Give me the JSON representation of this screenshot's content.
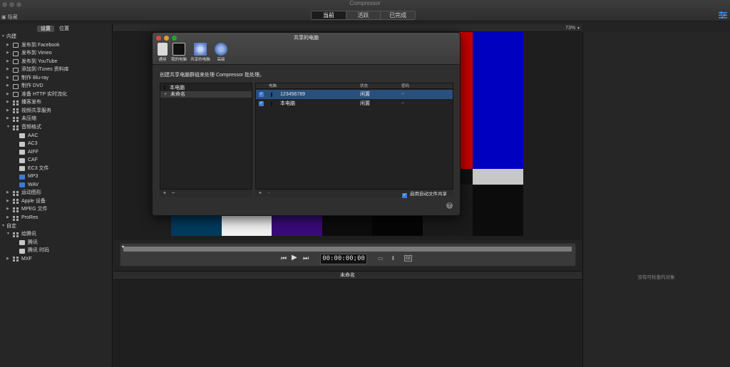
{
  "window": {
    "title": "Compressor",
    "segments": [
      "当前",
      "活跃",
      "已完成"
    ],
    "active_segment": 0,
    "sidebar_toggle": "隐藏"
  },
  "sidebar": {
    "tabs": [
      "设置",
      "位置"
    ],
    "active_tab": 0,
    "items": [
      {
        "label": "内建",
        "level": 0,
        "expanded": true,
        "icon": "none"
      },
      {
        "label": "发布到 Facebook",
        "level": 1,
        "icon": "share-icon"
      },
      {
        "label": "发布到 Vimeo",
        "level": 1,
        "icon": "share-icon"
      },
      {
        "label": "发布到 YouTube",
        "level": 1,
        "icon": "share-icon"
      },
      {
        "label": "添加到 iTunes 资料库",
        "level": 1,
        "icon": "share-icon"
      },
      {
        "label": "制作 Blu-ray",
        "level": 1,
        "icon": "share-icon"
      },
      {
        "label": "制作 DVD",
        "level": 1,
        "icon": "share-icon"
      },
      {
        "label": "准备 HTTP 实时流化",
        "level": 1,
        "icon": "share-icon"
      },
      {
        "label": "播客发布",
        "level": 1,
        "icon": "grid-icon"
      },
      {
        "label": "视频共享服务",
        "level": 1,
        "icon": "grid-icon"
      },
      {
        "label": "未压缩",
        "level": 1,
        "icon": "grid-icon"
      },
      {
        "label": "音频格式",
        "level": 1,
        "expanded": true,
        "icon": "grid-icon"
      },
      {
        "label": "AAC",
        "level": 2,
        "icon": "audio-file-icon"
      },
      {
        "label": "AC3",
        "level": 2,
        "icon": "audio-file-icon"
      },
      {
        "label": "AIFF",
        "level": 2,
        "icon": "audio-file-icon"
      },
      {
        "label": "CAF",
        "level": 2,
        "icon": "audio-file-icon"
      },
      {
        "label": "EC3 文件",
        "level": 2,
        "icon": "audio-file-icon"
      },
      {
        "label": "MP3",
        "level": 2,
        "icon": "music-file-icon"
      },
      {
        "label": "WAV",
        "level": 2,
        "icon": "music-file-icon"
      },
      {
        "label": "运动图形",
        "level": 1,
        "icon": "grid-icon"
      },
      {
        "label": "Apple 设备",
        "level": 1,
        "icon": "grid-icon"
      },
      {
        "label": "MPEG 文件",
        "level": 1,
        "icon": "grid-icon"
      },
      {
        "label": "ProRes",
        "level": 1,
        "icon": "grid-icon"
      },
      {
        "label": "自定",
        "level": 0,
        "expanded": true,
        "icon": "none"
      },
      {
        "label": "给腾讯",
        "level": 1,
        "expanded": true,
        "icon": "grid-icon"
      },
      {
        "label": "腾讯",
        "level": 2,
        "icon": "audio-file-icon"
      },
      {
        "label": "腾讯 时码",
        "level": 2,
        "icon": "audio-file-icon"
      },
      {
        "label": "MXF",
        "level": 1,
        "icon": "grid-icon"
      }
    ]
  },
  "viewer": {
    "zoom": "73%",
    "timecode": "00:00:00;00",
    "color_bars_top": [
      "#c8c8c8",
      "#c9c900",
      "#00c8c8",
      "#00c800",
      "#c800c8",
      "#c80000",
      "#0000c0"
    ],
    "color_bars_mid": [
      "#0000c0",
      "#111111",
      "#c800c8",
      "#111111",
      "#00c8c8",
      "#111111",
      "#c8c8c8"
    ],
    "color_bars_bottom": [
      "#003a5e",
      "#f0f0f0",
      "#3a0a7a",
      "#0c0c0c",
      "#050505",
      "#1a1a1a",
      "#0c0c0c"
    ]
  },
  "job": {
    "header": "未命名"
  },
  "inspector": {
    "empty_text": "没有可检查的对象"
  },
  "dialog": {
    "title": "共享的电脑",
    "toolbar": [
      {
        "label": "通用",
        "icon": "general-switch-icon"
      },
      {
        "label": "我的电脑",
        "icon": "my-computer-icon"
      },
      {
        "label": "共享的电脑",
        "icon": "shared-computers-icon"
      },
      {
        "label": "高级",
        "icon": "gear-icon"
      }
    ],
    "description": "创建共享电脑群组来处理 Compressor 批处理。",
    "groups": [
      {
        "label": "本电脑",
        "selected": false
      },
      {
        "label": "未命名",
        "selected": true
      }
    ],
    "columns": [
      "电脑",
      "状态",
      "密码"
    ],
    "computers": [
      {
        "checked": true,
        "name": "123456789",
        "status": "闲置",
        "password": "",
        "selected": true
      },
      {
        "checked": true,
        "name": "本电脑",
        "status": "闲置",
        "password": "",
        "selected": false
      }
    ],
    "auto_share_label": "启用自动文件共享",
    "auto_share_checked": true,
    "plus": "+",
    "minus": "−",
    "help": "?"
  }
}
